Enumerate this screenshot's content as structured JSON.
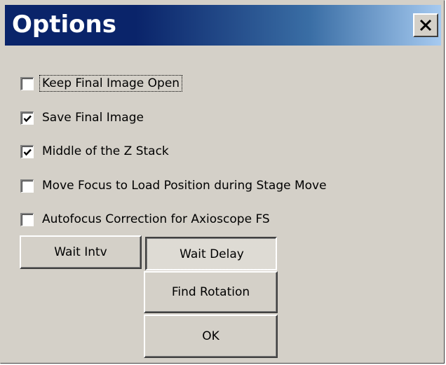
{
  "window": {
    "title": "Options",
    "close_label": "Close"
  },
  "checkboxes": [
    {
      "label": "Keep Final Image Open",
      "checked": false,
      "focused": true
    },
    {
      "label": "Save Final Image",
      "checked": true,
      "focused": false
    },
    {
      "label": "Middle of the Z Stack",
      "checked": true,
      "focused": false
    },
    {
      "label": "Move Focus to Load Position during Stage Move",
      "checked": false,
      "focused": false
    },
    {
      "label": "Autofocus Correction for Axioscope FS",
      "checked": false,
      "focused": false
    }
  ],
  "buttons": {
    "wait_intv": "Wait Intv",
    "wait_delay": "Wait Delay",
    "find_rotation": "Find Rotation",
    "ok": "OK"
  },
  "colors": {
    "dialog_face": "#d4d0c8",
    "titlebar_start": "#0a246a",
    "titlebar_end": "#a6caf0"
  },
  "icons": {
    "close": "close-x-icon",
    "check": "checkmark-icon"
  }
}
